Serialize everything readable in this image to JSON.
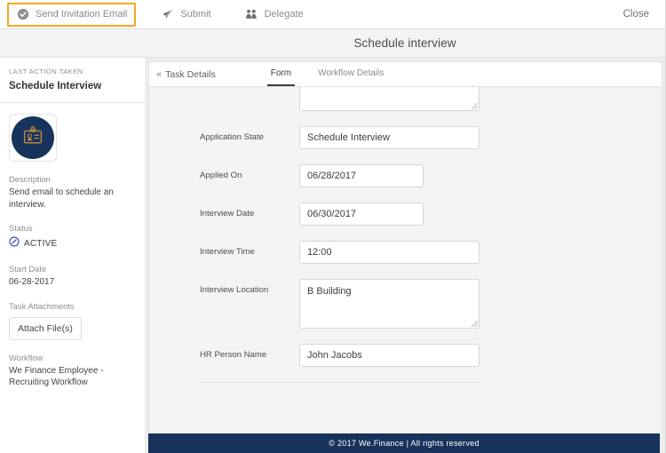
{
  "toolbar": {
    "actions": [
      {
        "label": "Send Invitation Email",
        "icon": "check-circle-icon",
        "focused": true
      },
      {
        "label": "Submit",
        "icon": "paper-plane-icon",
        "focused": false
      },
      {
        "label": "Delegate",
        "icon": "group-people-icon",
        "focused": false
      }
    ],
    "close_label": "Close"
  },
  "header": {
    "title": "Schedule interview"
  },
  "sidebar": {
    "kicker": "LAST ACTION TAKEN",
    "action_name": "Schedule Interview",
    "badge_icon": "id-badge-icon",
    "description_label": "Description",
    "description_value": "Send email to schedule an interview.",
    "status_label": "Status",
    "status_value": "ACTIVE",
    "status_icon": "clock-circle-icon",
    "start_date_label": "Start Date",
    "start_date_value": "06-28-2017",
    "attachments_label": "Task Attachments",
    "attach_button_label": "Attach File(s)",
    "workflow_label": "Workflow",
    "workflow_value": "We Finance Employee - Recruiting Workflow"
  },
  "content": {
    "task_details_label": "Task Details",
    "back_icon": "double-chevron-left-icon",
    "tabs": [
      {
        "label": "Form",
        "active": true
      },
      {
        "label": "Workflow Details",
        "active": false
      }
    ],
    "fields": [
      {
        "label": "",
        "value": "",
        "type": "textarea-clipped"
      },
      {
        "label": "Application State",
        "value": "Schedule Interview",
        "type": "text-wide"
      },
      {
        "label": "Applied On",
        "value": "06/28/2017",
        "type": "text-small"
      },
      {
        "label": "Interview Date",
        "value": "06/30/2017",
        "type": "text-small"
      },
      {
        "label": "Interview Time",
        "value": "12:00",
        "type": "text-wide"
      },
      {
        "label": "Interview Location",
        "value": "B Building",
        "type": "textarea"
      },
      {
        "label": "HR Person Name",
        "value": "John Jacobs",
        "type": "text-wide"
      }
    ]
  },
  "footer": {
    "text": "© 2017 We.Finance | All rights reserved"
  },
  "colors": {
    "navy": "#17335c",
    "focus_orange": "#f5a623",
    "status_blue": "#2b44c7",
    "badge_gold": "#c08a3e"
  }
}
